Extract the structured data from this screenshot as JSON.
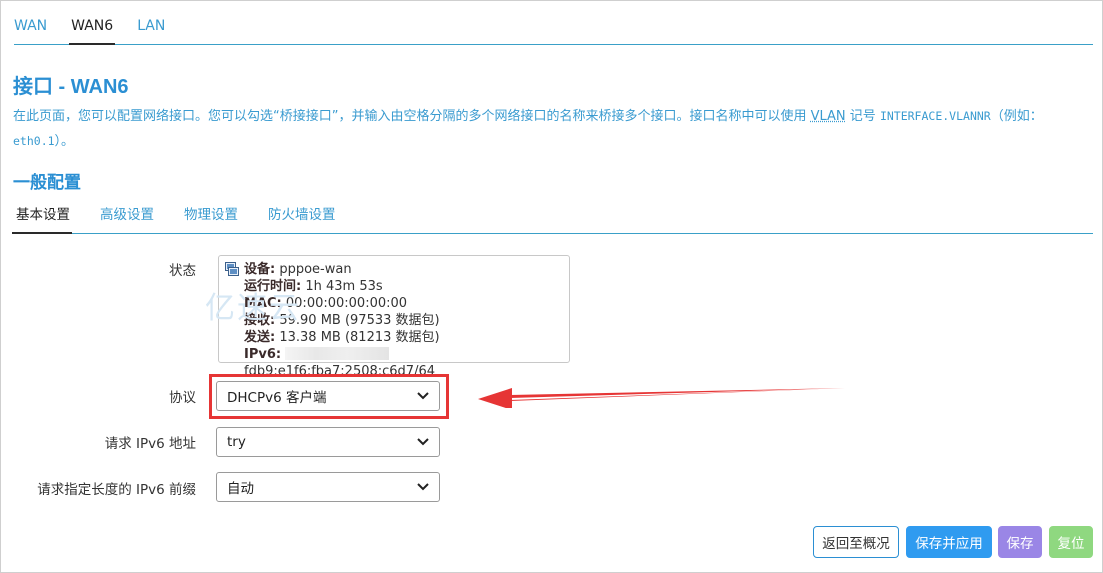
{
  "top_tabs": [
    "WAN",
    "WAN6",
    "LAN"
  ],
  "title": "接口 - WAN6",
  "description": {
    "part1": "在此页面，您可以配置网络接口。您可以勾选“桥接接口”，并输入由空格分隔的多个网络接口的名称来桥接多个接口。接口名称中可以使用 ",
    "vlan": "VLAN",
    "part2": " 记号 ",
    "code1": "INTERFACE.VLANNR",
    "part3": "（例如：",
    "code2": "eth0.1",
    "part4": "）。"
  },
  "section_title": "一般配置",
  "sub_tabs": [
    "基本设置",
    "高级设置",
    "物理设置",
    "防火墙设置"
  ],
  "status": {
    "label": "状态",
    "device_key": "设备:",
    "device_val": "pppoe-wan",
    "uptime_key": "运行时间:",
    "uptime_val": "1h 43m 53s",
    "mac_key": "MAC:",
    "mac_val": "00:00:00:00:00:00",
    "rx_key": "接收:",
    "rx_val": "59.90 MB (97533 数据包)",
    "tx_key": "发送:",
    "tx_val": "13.38 MB (81213 数据包)",
    "ipv6_key": "IPv6:",
    "ipv6_val": "fdb9:e1f6:fba7:2508:c6d7/64"
  },
  "watermark": "亿速云",
  "protocol": {
    "label": "协议",
    "value": "DHCPv6 客户端"
  },
  "request_ipv6": {
    "label": "请求 IPv6 地址",
    "value": "try"
  },
  "request_prefix": {
    "label": "请求指定长度的 IPv6 前缀",
    "value": "自动"
  },
  "buttons": {
    "back": "返回至概况",
    "save_apply": "保存并应用",
    "save": "保存",
    "reset": "复位"
  },
  "colors": {
    "accent": "#2b8fd3",
    "highlight": "#e63535",
    "save_apply_bg": "#2f9bf0",
    "save_bg": "#9a86e6",
    "reset_bg": "#8fd880"
  }
}
